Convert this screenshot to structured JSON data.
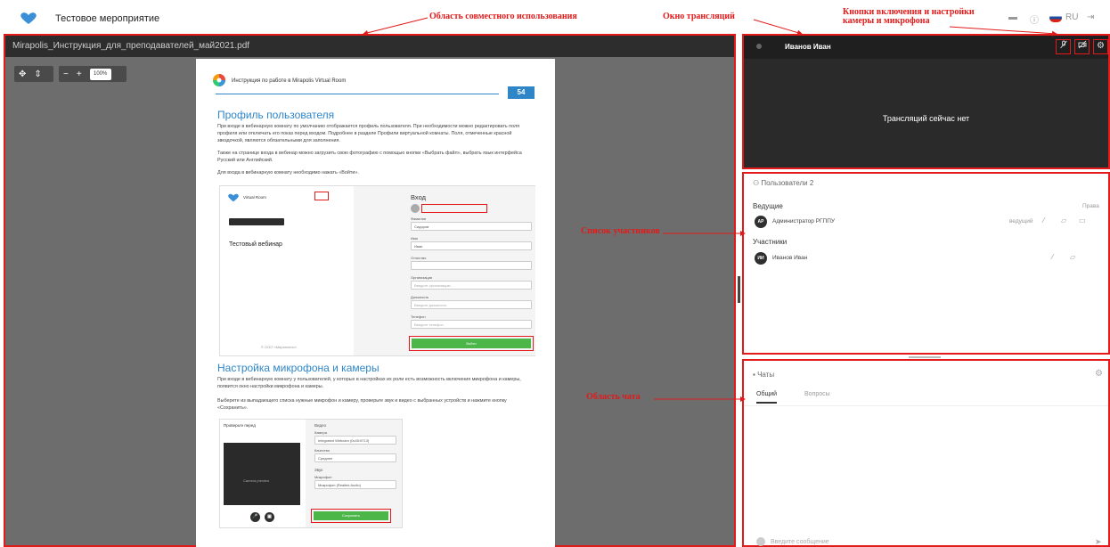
{
  "header": {
    "event_title": "Тестовое мероприятие",
    "lang": "RU"
  },
  "shared_area": {
    "file_name": "Mirapolis_Инструкция_для_преподавателей_май2021.pdf",
    "zoom": "100%",
    "page": {
      "doc_title": "Инструкция по работе в Mirapolis Virtual Room",
      "page_number": "54",
      "section1_title": "Профиль пользователя",
      "section1_p1": "При входе в вебинарную комнату по умолчанию отображается профиль пользователя. При необходимости можно редактировать поля профиля или отключать его показ перед входом. Подробнее в разделе Профили виртуальной комнаты. Поля, отмеченные красной звездочкой, являются обязательными для заполнения.",
      "section1_p2": "Также на странице входа в вебинар можно загрузить свою фотографию с помощью кнопки «Выбрать файл», выбрать язык интерфейса Русский или Английский.",
      "section1_p3": "Для входа в вебинарную комнату необходимо нажать «Войти».",
      "login": {
        "brand": "Virtual Room",
        "webinar_title": "Тестовый вебинар",
        "heading": "Вход",
        "fields": [
          "Фамилия",
          "Имя",
          "Отчество",
          "Организация",
          "Должность",
          "Телефон"
        ],
        "values": [
          "Сидоров",
          "Иван",
          "",
          "Введите организацию",
          "Введите должность",
          "Введите телефон"
        ],
        "submit": "Войти",
        "footer": "© ООО «Мираполис»"
      },
      "section2_title": "Настройка микрофона и камеры",
      "section2_p1": "При входе в вебинарную комнату у пользователей, у которых в настройках их роли есть возможность включения микрофона и камеры, появится окно настройки микрофона и камеры.",
      "section2_p2": "Выберете из выпадающего списка нужные микрофон и камеру, проверьте звук и видео с выбранных устройств и нажмите кнопку «Сохранить».",
      "settings": {
        "title": "Проверьте перед",
        "video_label": "Видео",
        "camera_label": "Камера",
        "quality_label": "Качество",
        "sound_label": "Звук",
        "mic_label": "Микрофон",
        "camera_value": "Integrated Webcam (0c45:6713)",
        "quality_value": "Среднее",
        "mic_value": "Микрофон (Realtek Audio)",
        "save": "Сохранить",
        "preview_text": "Camera preview"
      }
    }
  },
  "broadcast": {
    "user_name": "Иванов Иван",
    "empty_text": "Трансляций сейчас нет"
  },
  "users_panel": {
    "title": "Пользователи",
    "count": "2",
    "group_hosts": "Ведущие",
    "rights": "Права",
    "host": {
      "initials": "АР",
      "name": "Администратор РГППУ",
      "role": "ведущий"
    },
    "group_participants": "Участники",
    "participant": {
      "initials": "ИИ",
      "name": "Иванов Иван"
    }
  },
  "chat_panel": {
    "title": "Чаты",
    "tabs": [
      "Общий",
      "Вопросы"
    ],
    "input_placeholder": "Введите сообщение"
  },
  "annotations": {
    "shared": "Область совместного использования",
    "broadcast": "Окно трансляций",
    "camera_mic": "Кнопки включения и настройки камеры и микрофона",
    "participants": "Список участников",
    "chat": "Область чата"
  },
  "colors": {
    "annotation_red": "#e21a1a",
    "accent_blue": "#2e86c8",
    "button_green": "#4cb648"
  }
}
